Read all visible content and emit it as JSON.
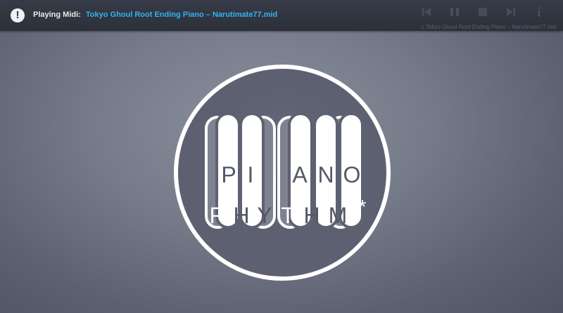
{
  "notification": {
    "icon": "exclamation-icon",
    "label": "Playing Midi:",
    "title": "Tokyo Ghoul Root Ending Piano – Narutimate77.mid"
  },
  "player": {
    "buttons": [
      "previous-icon",
      "pause-icon",
      "stop-icon",
      "next-icon",
      "info-icon"
    ],
    "track_text": "♫ Tokyo Ghoul Root Ending Piano – Narutimate77.mid"
  },
  "logo": {
    "row1": [
      "P",
      "I",
      "A",
      "N",
      "O"
    ],
    "row2": [
      "R",
      "H",
      "Y",
      "T",
      "H",
      "M",
      "*"
    ]
  },
  "colors": {
    "topbar": "#2f333d",
    "accent": "#35b3f0",
    "logo_circle": "#5e6171",
    "logo_ring": "#ffffff",
    "logo_text": "#555866"
  }
}
